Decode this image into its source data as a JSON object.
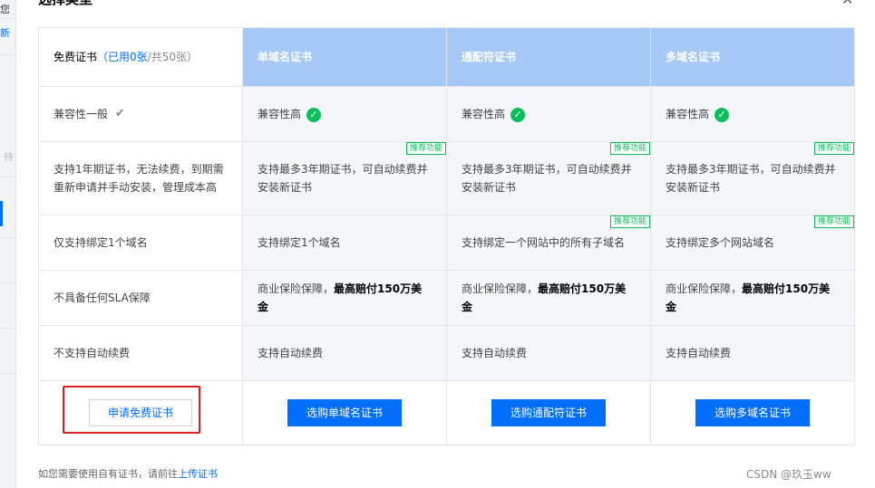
{
  "background_left": {
    "text1": "您",
    "text2": "新",
    "text3": "待"
  },
  "dialog": {
    "title": "选择类型",
    "close_icon": "close-icon"
  },
  "table": {
    "free_header": {
      "label": "免费证书",
      "used": "（已用0张",
      "quota": "/共50张）"
    },
    "paid_headers": [
      "单域名证书",
      "通配符证书",
      "多域名证书"
    ],
    "recommend_tag": "推荐功能",
    "rows": {
      "compat": [
        "兼容性一般",
        "兼容性高",
        "兼容性高",
        "兼容性高"
      ],
      "term": [
        "支持1年期证书，无法续费，到期需重新申请并手动安装，管理成本高",
        "支持最多3年期证书，可自动续费并安装新证书",
        "支持最多3年期证书，可自动续费并安装新证书",
        "支持最多3年期证书，可自动续费并安装新证书"
      ],
      "domain": [
        "仅支持绑定1个域名",
        "支持绑定1个域名",
        "支持绑定一个网站中的所有子域名",
        "支持绑定多个网站域名"
      ],
      "sla_free": "不具备任何SLA保障",
      "sla_paid_prefix": "商业保险保障，",
      "sla_paid_bold": "最高赔付150万美金",
      "renew": [
        "不支持自动续费",
        "支持自动续费",
        "支持自动续费",
        "支持自动续费"
      ]
    },
    "buttons": [
      "申请免费证书",
      "选购单域名证书",
      "选购通配符证书",
      "选购多域名证书"
    ]
  },
  "footer": {
    "text": "如您需要使用自有证书，请前往",
    "link": "上传证书"
  },
  "watermark": "CSDN @玖玉ww",
  "colors": {
    "primary": "#006eff",
    "success": "#0abf5b",
    "highlight": "#e0201f",
    "header_blue": "#a6c9f7"
  }
}
